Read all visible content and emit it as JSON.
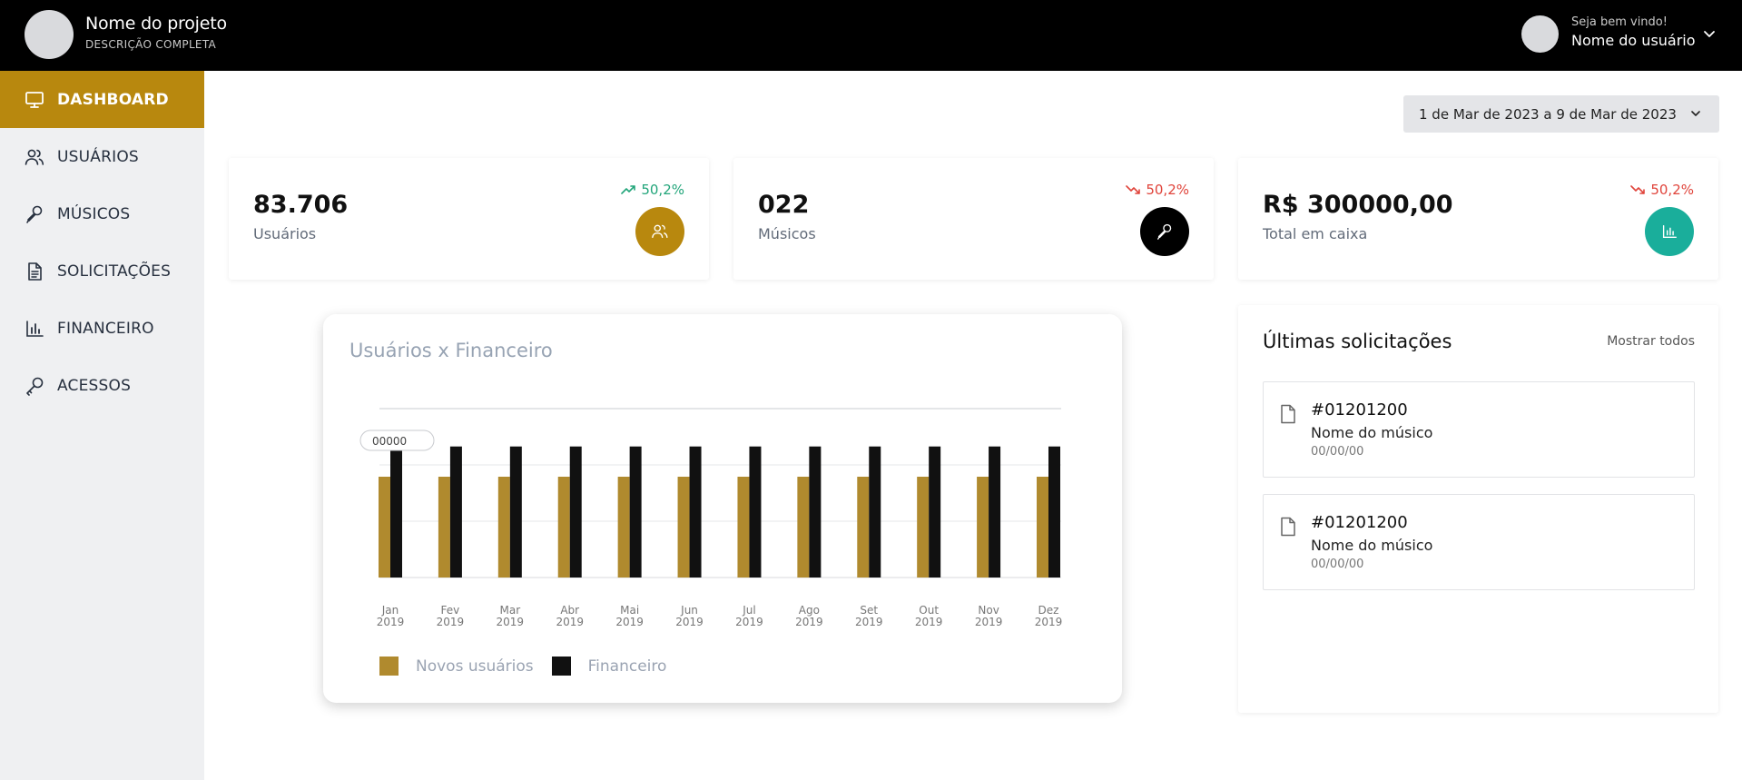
{
  "header": {
    "project_name": "Nome do projeto",
    "project_description": "DESCRIÇÃO COMPLETA",
    "greeting": "Seja bem vindo!",
    "user_name": "Nome do usuário"
  },
  "sidebar": {
    "items": [
      {
        "label": "DASHBOARD",
        "icon": "monitor-icon",
        "active": true
      },
      {
        "label": "USUÁRIOS",
        "icon": "users-icon",
        "active": false
      },
      {
        "label": "MÚSICOS",
        "icon": "microphone-icon",
        "active": false
      },
      {
        "label": "SOLICITAÇÕES",
        "icon": "document-icon",
        "active": false
      },
      {
        "label": "FINANCEIRO",
        "icon": "bar-chart-icon",
        "active": false
      },
      {
        "label": "ACESSOS",
        "icon": "key-icon",
        "active": false
      }
    ]
  },
  "date_range": {
    "label": "1 de Mar de 2023 a 9 de Mar de 2023"
  },
  "stats": [
    {
      "value": "83.706",
      "label": "Usuários",
      "trend": "50,2%",
      "trend_dir": "up",
      "icon": "users-icon",
      "icon_bg": "#b8880e"
    },
    {
      "value": "022",
      "label": "Músicos",
      "trend": "50,2%",
      "trend_dir": "down",
      "icon": "microphone-icon",
      "icon_bg": "#000000"
    },
    {
      "value": "R$ 300000,00",
      "label": "Total em caixa",
      "trend": "50,2%",
      "trend_dir": "down",
      "icon": "bar-chart-icon",
      "icon_bg": "#1aae9b"
    }
  ],
  "chart": {
    "title": "Usuários x Financeiro",
    "tooltip": "00000",
    "legend": [
      "Novos usuários",
      "Financeiro"
    ]
  },
  "chart_data": {
    "type": "bar",
    "title": "Usuários x Financeiro",
    "categories": [
      "Jan 2019",
      "Fev 2019",
      "Mar 2019",
      "Abr 2019",
      "Mai 2019",
      "Jun 2019",
      "Jul 2019",
      "Ago 2019",
      "Set 2019",
      "Out 2019",
      "Nov 2019",
      "Dez 2019"
    ],
    "series": [
      {
        "name": "Novos usuários",
        "color": "#b08a2e",
        "values": [
          0.6,
          0.6,
          0.6,
          0.6,
          0.6,
          0.6,
          0.6,
          0.6,
          0.6,
          0.6,
          0.6,
          0.6
        ]
      },
      {
        "name": "Financeiro",
        "color": "#111111",
        "values": [
          0.78,
          0.78,
          0.78,
          0.78,
          0.78,
          0.78,
          0.78,
          0.78,
          0.78,
          0.78,
          0.78,
          0.78
        ]
      }
    ],
    "ylim": [
      0,
      1
    ],
    "grid": true,
    "legend_position": "bottom-left"
  },
  "requests": {
    "title": "Últimas solicitações",
    "show_all": "Mostrar todos",
    "items": [
      {
        "id": "#01201200",
        "name": "Nome do músico",
        "date": "00/00/00"
      },
      {
        "id": "#01201200",
        "name": "Nome do músico",
        "date": "00/00/00"
      }
    ]
  },
  "colors": {
    "accent": "#b8880e",
    "header_bg": "#000000",
    "sidebar_bg": "#eff0f2",
    "trend_up": "#22a57a",
    "trend_down": "#e0443b",
    "teal": "#1aae9b"
  }
}
